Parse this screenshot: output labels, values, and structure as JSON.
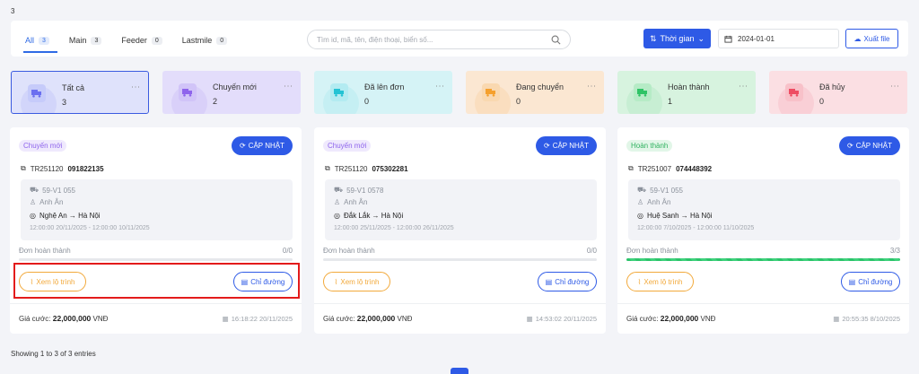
{
  "top_number": "3",
  "tabs": [
    {
      "label": "All",
      "count": "3"
    },
    {
      "label": "Main",
      "count": "3"
    },
    {
      "label": "Feeder",
      "count": "0"
    },
    {
      "label": "Lastmile",
      "count": "0"
    }
  ],
  "search": {
    "placeholder": "Tìm id, mã, tên, điện thoại, biển số..."
  },
  "toolbar": {
    "time_label": "Thời gian",
    "date_value": "2024-01-01",
    "export_label": "Xuất file"
  },
  "stats": [
    {
      "label": "Tất cả",
      "value": "3",
      "bg": "#dfe2fb",
      "icon_color": "#6b6ff0"
    },
    {
      "label": "Chuyến mới",
      "value": "2",
      "bg": "#e3ddfb",
      "icon_color": "#8e64ec"
    },
    {
      "label": "Đã lên đơn",
      "value": "0",
      "bg": "#d5f3f6",
      "icon_color": "#24c3d4"
    },
    {
      "label": "Đang chuyển",
      "value": "0",
      "bg": "#fbe7d2",
      "icon_color": "#f5a02d"
    },
    {
      "label": "Hoàn thành",
      "value": "1",
      "bg": "#d7f3df",
      "icon_color": "#2fc466"
    },
    {
      "label": "Đã hủy",
      "value": "0",
      "bg": "#fbdfe3",
      "icon_color": "#ee4d63"
    }
  ],
  "cards": [
    {
      "status": "Chuyến mới",
      "status_color": "#8e64ec",
      "status_bg": "#efe9fd",
      "update_label": "CẬP NHẬT",
      "trip_code": "TR251120",
      "phone": "091822135",
      "plate": "59-V1 055",
      "driver": "Anh Ân",
      "route": "Nghệ An → Hà Nội",
      "time_range": "12:00:00 20/11/2025 - 12:00:00 10/11/2025",
      "done_label": "Đơn hoàn thành",
      "done_count": "0/0",
      "progress": 0,
      "view_route_label": "Xem lộ trình",
      "directions_label": "Chỉ đường",
      "price_label": "Giá cước:",
      "price_value": "22,000,000",
      "currency": "VNĐ",
      "timestamp": "16:18:22 20/11/2025"
    },
    {
      "status": "Chuyến mới",
      "status_color": "#8e64ec",
      "status_bg": "#efe9fd",
      "update_label": "CẬP NHẬT",
      "trip_code": "TR251120",
      "phone": "075302281",
      "plate": "59-V1 0578",
      "driver": "Anh Ân",
      "route": "Đắk Lắk → Hà Nội",
      "time_range": "12:00:00 25/11/2025 - 12:00:00 26/11/2025",
      "done_label": "Đơn hoàn thành",
      "done_count": "0/0",
      "progress": 0,
      "view_route_label": "Xem lộ trình",
      "directions_label": "Chỉ đường",
      "price_label": "Giá cước:",
      "price_value": "22,000,000",
      "currency": "VNĐ",
      "timestamp": "14:53:02 20/11/2025"
    },
    {
      "status": "Hoàn thành",
      "status_color": "#2fb25f",
      "status_bg": "#e2f6e8",
      "update_label": "CẬP NHẬT",
      "trip_code": "TR251007",
      "phone": "074448392",
      "plate": "59-V1 055",
      "driver": "Anh Ân",
      "route": "Huệ Sanh → Hà Nội",
      "time_range": "12:00:00 7/10/2025 - 12:00:00 11/10/2025",
      "done_label": "Đơn hoàn thành",
      "done_count": "3/3",
      "progress": 1,
      "view_route_label": "Xem lộ trình",
      "directions_label": "Chỉ đường",
      "price_label": "Giá cước:",
      "price_value": "22,000,000",
      "currency": "VNĐ",
      "timestamp": "20:55:35 8/10/2025"
    }
  ],
  "footer": {
    "entries": "Showing 1 to 3 of 3 entries"
  },
  "colors": {
    "primary": "#2e5ae6",
    "highlight": "#e31b1b",
    "accent_orange": "#f2a93b"
  }
}
